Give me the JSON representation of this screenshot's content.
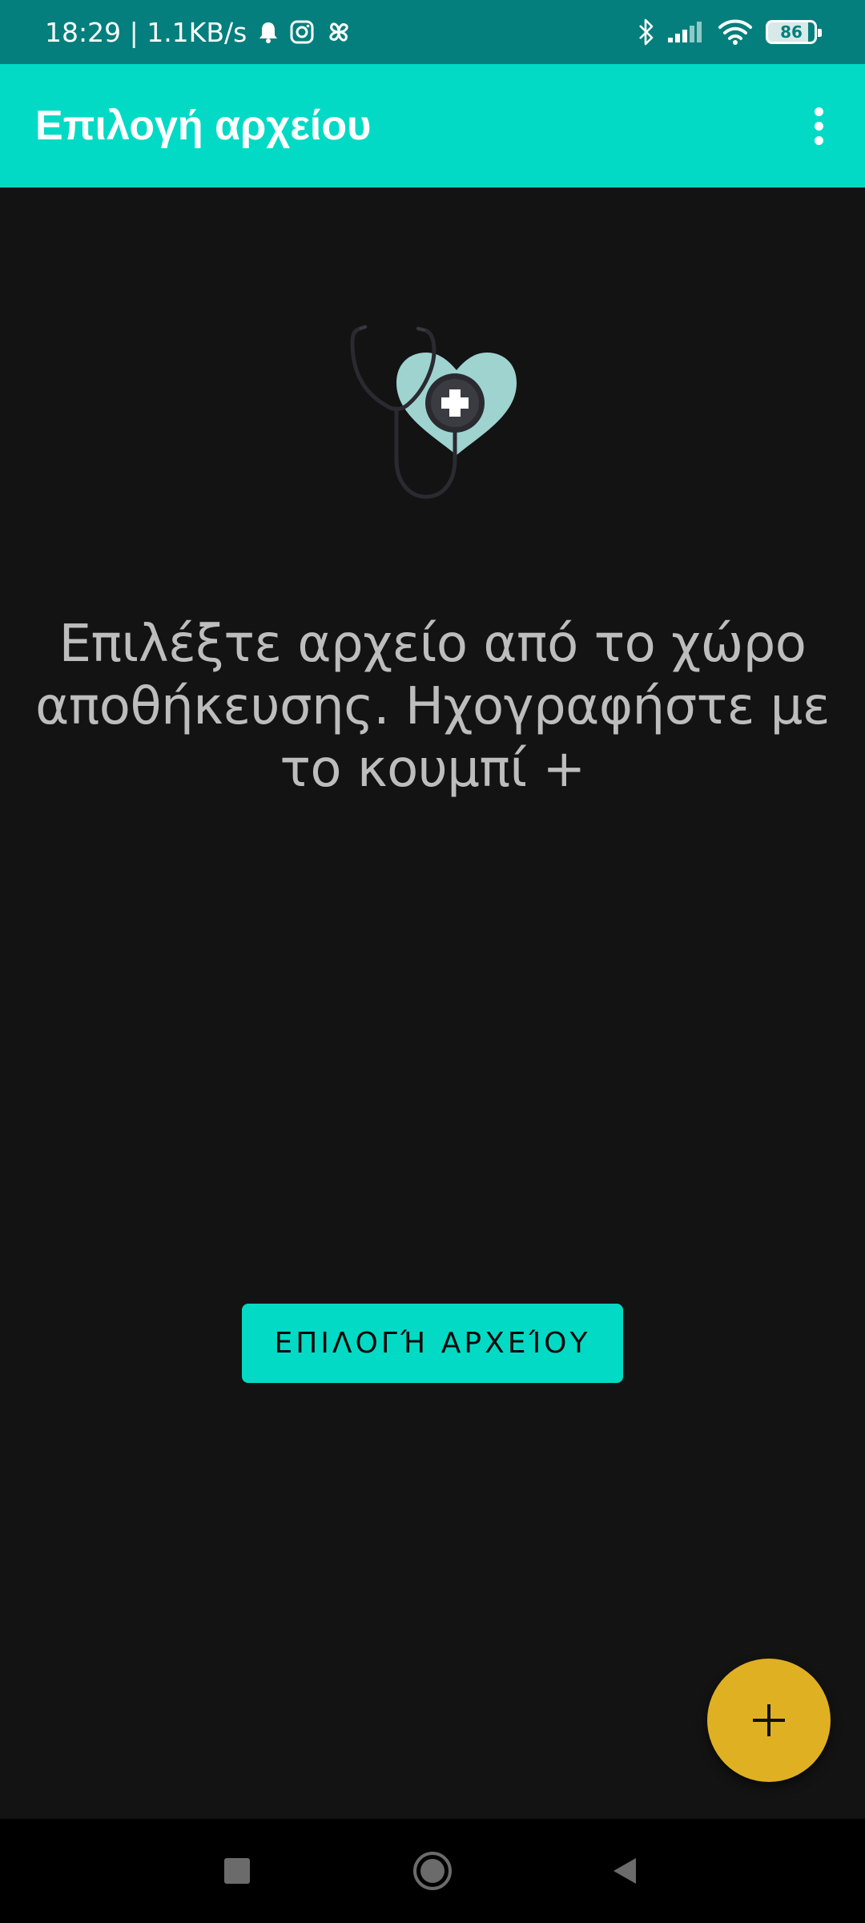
{
  "status_bar": {
    "time_speed": "18:29 | 1.1KB/s",
    "icons": [
      "notification-bell-icon",
      "instagram-icon",
      "pinwheel-icon",
      "bluetooth-icon",
      "signal-icon",
      "wifi-icon",
      "battery-icon"
    ],
    "battery_level": "86"
  },
  "app_bar": {
    "title": "Επιλογή αρχείου",
    "menu_icon": "more-vert-icon"
  },
  "main": {
    "illustration_icon": "stethoscope-heart-icon",
    "message": "Επιλέξτε αρχείο από το χώρο αποθήκευσης. Ηχογραφήστε με το κουμπί +",
    "select_button_label": "ΕΠΙΛΟΓΉ ΑΡΧΕΊΟΥ",
    "fab_icon": "plus-icon"
  },
  "nav_bar": {
    "buttons": [
      "recents-square-icon",
      "home-circle-icon",
      "back-triangle-icon"
    ]
  },
  "colors": {
    "status_bar": "#047f7d",
    "app_bar": "#03dac5",
    "background": "#131313",
    "fab": "#e0b023",
    "message_text": "#bdbdbd"
  }
}
